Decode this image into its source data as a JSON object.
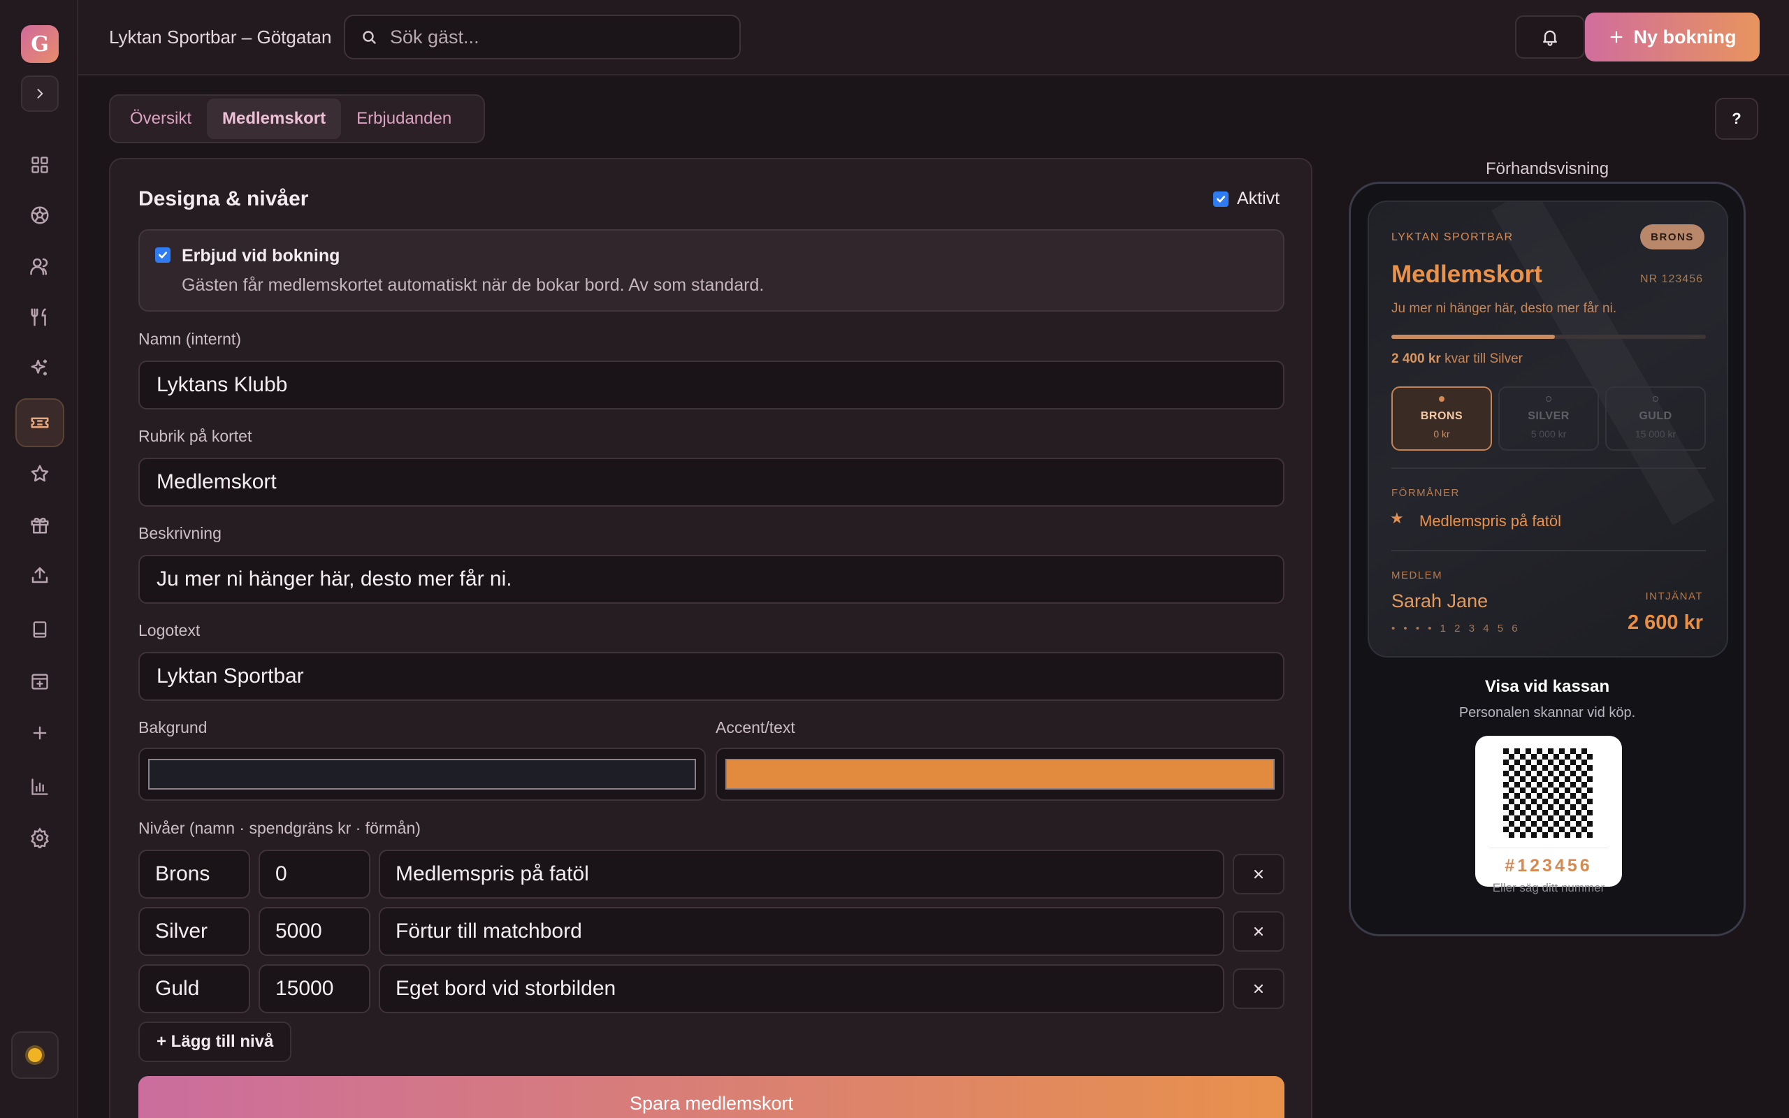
{
  "app": {
    "logo_letter": "G",
    "venue_title": "Lyktan Sportbar – Götgatan",
    "accent_gradient": [
      "#d06a9d",
      "#e8945e"
    ]
  },
  "sidebar": {
    "items": [
      {
        "icon": "grid-icon",
        "active": false
      },
      {
        "icon": "soccer-ball-icon",
        "active": false
      },
      {
        "icon": "users-icon",
        "active": false
      },
      {
        "icon": "utensils-icon",
        "active": false
      },
      {
        "icon": "sparkles-icon",
        "active": false
      },
      {
        "icon": "ticket-icon",
        "active": true
      },
      {
        "icon": "star-icon",
        "active": false
      },
      {
        "icon": "gift-icon",
        "active": false
      },
      {
        "icon": "upload-icon",
        "active": false
      },
      {
        "icon": "tablet-icon",
        "active": false
      },
      {
        "icon": "calendar-plus-icon",
        "active": false
      },
      {
        "icon": "plus-icon",
        "active": false
      },
      {
        "icon": "bar-chart-icon",
        "active": false
      },
      {
        "icon": "settings-icon",
        "active": false
      }
    ],
    "theme_icon": "sun-icon"
  },
  "header": {
    "search_placeholder": "Sök gäst...",
    "new_booking_label": "Ny bokning"
  },
  "tabs": [
    {
      "label": "Översikt",
      "active": false
    },
    {
      "label": "Medlemskort",
      "active": true
    },
    {
      "label": "Erbjudanden",
      "active": false
    }
  ],
  "help_label": "?",
  "form": {
    "title": "Designa & nivåer",
    "active_label": "Aktivt",
    "active_checked": true,
    "offer": {
      "checked": true,
      "title": "Erbjud vid bokning",
      "description": "Gästen får medlemskortet automatiskt när de bokar bord. Av som standard."
    },
    "name_label": "Namn (internt)",
    "name_value": "Lyktans Klubb",
    "heading_label": "Rubrik på kortet",
    "heading_value": "Medlemskort",
    "description_label": "Beskrivning",
    "description_value": "Ju mer ni hänger här, desto mer får ni.",
    "logo_label": "Logotext",
    "logo_value": "Lyktan Sportbar",
    "background_label": "Bakgrund",
    "background_color": "#1e1f26",
    "accent_label": "Accent/text",
    "accent_color": "#e28a3e",
    "tiers_label": "Nivåer (namn · spendgräns kr · förmån)",
    "tiers": [
      {
        "name": "Brons",
        "threshold": "0",
        "perk": "Medlemspris på fatöl"
      },
      {
        "name": "Silver",
        "threshold": "5000",
        "perk": "Förtur till matchbord"
      },
      {
        "name": "Guld",
        "threshold": "15000",
        "perk": "Eget bord vid storbilden"
      }
    ],
    "add_tier_label": "+ Lägg till nivå",
    "save_label": "Spara medlemskort"
  },
  "preview": {
    "label": "Förhandsvisning",
    "card": {
      "brand": "LYKTAN SPORTBAR",
      "tier_badge": "BRONS",
      "title": "Medlemskort",
      "number": "NR 123456",
      "description": "Ju mer ni hänger här, desto mer får ni.",
      "progress_fraction": 0.52,
      "remaining_amount": "2 400 kr",
      "remaining_text": " kvar till Silver",
      "tiers": [
        {
          "name": "BRONS",
          "min": "0 kr",
          "current": true
        },
        {
          "name": "SILVER",
          "min": "5 000 kr",
          "current": false
        },
        {
          "name": "GULD",
          "min": "15 000 kr",
          "current": false
        }
      ],
      "perks_label": "FÖRMÅNER",
      "perk": "Medlemspris på fatöl",
      "member_label": "MEDLEM",
      "member_name": "Sarah Jane",
      "member_number": "• • • •  1 2 3 4 5 6",
      "earned_label": "INTJÄNAT",
      "earned_value": "2 600 kr"
    },
    "checkout_title": "Visa vid kassan",
    "checkout_subtitle": "Personalen skannar vid köp.",
    "qr_number": "#123456",
    "qr_hint": "Eller säg ditt nummer"
  }
}
